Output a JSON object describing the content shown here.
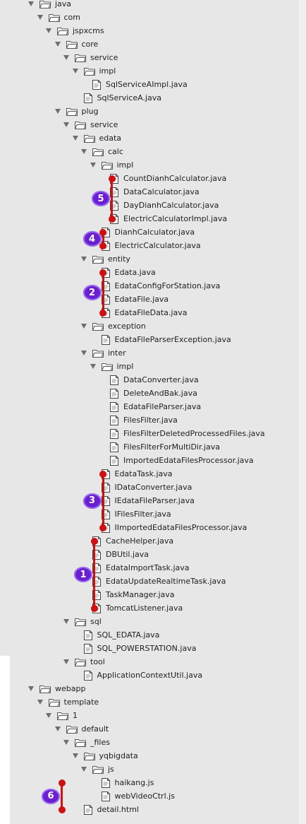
{
  "tree": [
    {
      "label": "java",
      "type": "folder",
      "depth": 0,
      "expanded": true
    },
    {
      "label": "com",
      "type": "folder",
      "depth": 1,
      "expanded": true
    },
    {
      "label": "jspxcms",
      "type": "folder",
      "depth": 2,
      "expanded": true
    },
    {
      "label": "core",
      "type": "folder",
      "depth": 3,
      "expanded": true
    },
    {
      "label": "service",
      "type": "folder",
      "depth": 4,
      "expanded": true
    },
    {
      "label": "impl",
      "type": "folder",
      "depth": 5,
      "expanded": true
    },
    {
      "label": "SqlServiceAImpl.java",
      "type": "file",
      "depth": 6
    },
    {
      "label": "SqlServiceA.java",
      "type": "file",
      "depth": 5
    },
    {
      "label": "plug",
      "type": "folder",
      "depth": 3,
      "expanded": true
    },
    {
      "label": "service",
      "type": "folder",
      "depth": 4,
      "expanded": true
    },
    {
      "label": "edata",
      "type": "folder",
      "depth": 5,
      "expanded": true
    },
    {
      "label": "calc",
      "type": "folder",
      "depth": 6,
      "expanded": true
    },
    {
      "label": "impl",
      "type": "folder",
      "depth": 7,
      "expanded": true
    },
    {
      "label": "CountDianhCalculator.java",
      "type": "file",
      "depth": 8
    },
    {
      "label": "DataCalculator.java",
      "type": "file",
      "depth": 8
    },
    {
      "label": "DayDianhCalculator.java",
      "type": "file",
      "depth": 8
    },
    {
      "label": "ElectricCalculatorImpl.java",
      "type": "file",
      "depth": 8
    },
    {
      "label": "DianhCalculator.java",
      "type": "file",
      "depth": 7
    },
    {
      "label": "ElectricCalculator.java",
      "type": "file",
      "depth": 7
    },
    {
      "label": "entity",
      "type": "folder",
      "depth": 6,
      "expanded": true
    },
    {
      "label": "Edata.java",
      "type": "file",
      "depth": 7
    },
    {
      "label": "EdataConfigForStation.java",
      "type": "file",
      "depth": 7
    },
    {
      "label": "EdataFile.java",
      "type": "file",
      "depth": 7
    },
    {
      "label": "EdataFileData.java",
      "type": "file",
      "depth": 7
    },
    {
      "label": "exception",
      "type": "folder",
      "depth": 6,
      "expanded": true
    },
    {
      "label": "EdataFileParserException.java",
      "type": "file",
      "depth": 7
    },
    {
      "label": "inter",
      "type": "folder",
      "depth": 6,
      "expanded": true
    },
    {
      "label": "impl",
      "type": "folder",
      "depth": 7,
      "expanded": true
    },
    {
      "label": "DataConverter.java",
      "type": "file",
      "depth": 8
    },
    {
      "label": "DeleteAndBak.java",
      "type": "file",
      "depth": 8
    },
    {
      "label": "EdataFileParser.java",
      "type": "file",
      "depth": 8
    },
    {
      "label": "FilesFilter.java",
      "type": "file",
      "depth": 8
    },
    {
      "label": "FilesFilterDeletedProcessedFiles.java",
      "type": "file",
      "depth": 8
    },
    {
      "label": "FilesFilterForMultiDir.java",
      "type": "file",
      "depth": 8
    },
    {
      "label": "ImportedEdataFilesProcessor.java",
      "type": "file",
      "depth": 8
    },
    {
      "label": "EdataTask.java",
      "type": "file",
      "depth": 7
    },
    {
      "label": "IDataConverter.java",
      "type": "file",
      "depth": 7
    },
    {
      "label": "IEdataFileParser.java",
      "type": "file",
      "depth": 7
    },
    {
      "label": "IFilesFilter.java",
      "type": "file",
      "depth": 7
    },
    {
      "label": "IImportedEdataFilesProcessor.java",
      "type": "file",
      "depth": 7
    },
    {
      "label": "CacheHelper.java",
      "type": "file",
      "depth": 6
    },
    {
      "label": "DBUtil.java",
      "type": "file",
      "depth": 6
    },
    {
      "label": "EdataImportTask.java",
      "type": "file",
      "depth": 6
    },
    {
      "label": "EdataUpdateRealtimeTask.java",
      "type": "file",
      "depth": 6
    },
    {
      "label": "TaskManager.java",
      "type": "file",
      "depth": 6
    },
    {
      "label": "TomcatListener.java",
      "type": "file",
      "depth": 6
    },
    {
      "label": "sql",
      "type": "folder",
      "depth": 4,
      "expanded": true
    },
    {
      "label": "SQL_EDATA.java",
      "type": "file",
      "depth": 5
    },
    {
      "label": "SQL_POWERSTATION.java",
      "type": "file",
      "depth": 5
    },
    {
      "label": "tool",
      "type": "folder",
      "depth": 4,
      "expanded": true
    },
    {
      "label": "ApplicationContextUtil.java",
      "type": "file",
      "depth": 5
    },
    {
      "label": "webapp",
      "type": "folder",
      "depth": 0,
      "expanded": true
    },
    {
      "label": "template",
      "type": "folder",
      "depth": 1,
      "expanded": true
    },
    {
      "label": "1",
      "type": "folder",
      "depth": 2,
      "expanded": true
    },
    {
      "label": "default",
      "type": "folder",
      "depth": 3,
      "expanded": true
    },
    {
      "label": "_files",
      "type": "folder",
      "depth": 4,
      "expanded": true
    },
    {
      "label": "yqbigdata",
      "type": "folder",
      "depth": 5,
      "expanded": true
    },
    {
      "label": "js",
      "type": "folder",
      "depth": 6,
      "expanded": true
    },
    {
      "label": "haikang.js",
      "type": "file",
      "depth": 7
    },
    {
      "label": "webVideoCtrl.js",
      "type": "file",
      "depth": 7
    },
    {
      "label": "detail.html",
      "type": "file",
      "depth": 5
    }
  ],
  "annotations": [
    {
      "number": "5",
      "first": 13,
      "last": 16
    },
    {
      "number": "4",
      "first": 17,
      "last": 18
    },
    {
      "number": "2",
      "first": 20,
      "last": 23
    },
    {
      "number": "3",
      "first": 35,
      "last": 39
    },
    {
      "number": "1",
      "first": 40,
      "last": 45
    },
    {
      "number": "6",
      "first": 58,
      "last": 60
    }
  ],
  "colors": {
    "annotation_line": "#d01010",
    "badge": "#6a1fd1"
  }
}
